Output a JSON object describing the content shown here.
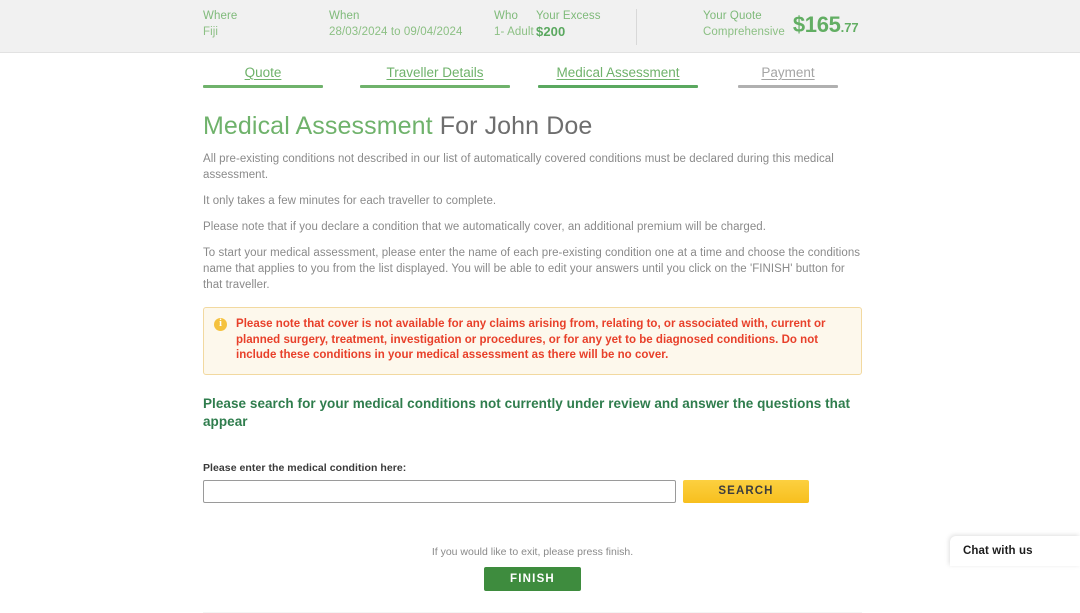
{
  "summary": {
    "where": {
      "label": "Where",
      "value": "Fiji"
    },
    "when": {
      "label": "When",
      "value": "28/03/2024 to 09/04/2024"
    },
    "who": {
      "label": "Who",
      "value": "1- Adult"
    },
    "excess": {
      "label": "Your Excess",
      "value": "$200"
    },
    "quote": {
      "label": "Your Quote",
      "plan": "Comprehensive",
      "price_dollars": "$165",
      "price_cents": ".77"
    }
  },
  "steps": [
    {
      "label": "Quote",
      "state": "done"
    },
    {
      "label": "Traveller Details",
      "state": "done"
    },
    {
      "label": "Medical Assessment",
      "state": "active"
    },
    {
      "label": "Payment",
      "state": "todo"
    }
  ],
  "page": {
    "title_highlight": "Medical Assessment",
    "title_rest": " For John Doe",
    "paragraphs": [
      "All pre-existing conditions not described in our list of automatically covered conditions must be declared during this medical assessment.",
      "It only takes a few minutes for each traveller to complete.",
      "Please note that if you declare a condition that we automatically cover, an additional premium will be charged.",
      "To start your medical assessment, please enter the name of each pre-existing condition one at a time and choose the conditions name that applies to you from the list displayed. You will be able to edit your answers until you click on the 'FINISH' button for that traveller."
    ],
    "callout": {
      "icon": "info-icon",
      "text": "Please note that cover is not available for any claims arising from, relating to, or associated with, current or planned surgery, treatment, investigation or procedures, or for any yet to be diagnosed conditions. Do not include these conditions in your medical assessment as there will be no cover."
    },
    "section_heading": "Please search for your medical conditions not currently under review and answer the questions that appear",
    "search": {
      "label": "Please enter the medical condition here:",
      "value": "",
      "placeholder": "",
      "button_label": "SEARCH"
    },
    "finish": {
      "hint": "If you would like to exit, please press finish.",
      "button_label": "FINISH"
    }
  },
  "chat": {
    "label": "Chat with us"
  },
  "colors": {
    "brand_green": "#6fb26b",
    "heading_green": "#2f7d4d",
    "accent_yellow": "#f7bf1e",
    "finish_green": "#3e8c3e",
    "warning_red": "#e8402a",
    "callout_bg": "#fdf8ec",
    "callout_border": "#f2d9a0",
    "bar_bg": "#f1f1f1"
  }
}
